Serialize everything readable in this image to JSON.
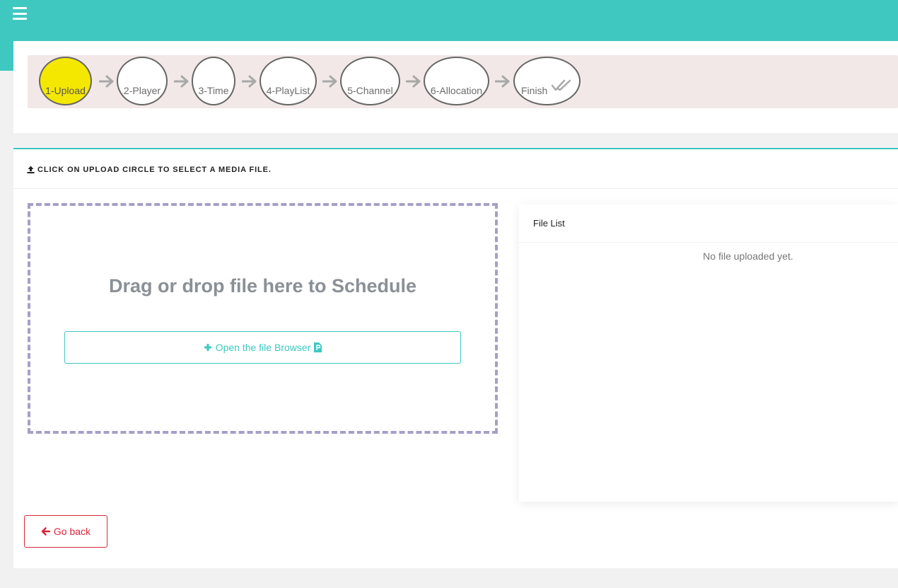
{
  "header": {
    "menu_icon": "hamburger-icon",
    "color": "#3ec8c0"
  },
  "wizard": {
    "steps": [
      {
        "label": "1-Upload",
        "active": true
      },
      {
        "label": "2-Player",
        "active": false
      },
      {
        "label": "3-Time",
        "active": false
      },
      {
        "label": "4-PlayList",
        "active": false
      },
      {
        "label": "5-Channel",
        "active": false
      },
      {
        "label": "6-Allocation",
        "active": false
      },
      {
        "label": "Finish",
        "active": false,
        "icon": "double-check-icon"
      }
    ],
    "active_color": "#f5e800"
  },
  "upload": {
    "heading": "CLICK ON UPLOAD CIRCLE TO SELECT A MEDIA FILE.",
    "heading_icon": "upload-icon",
    "drop_text": "Drag or drop file here to Schedule",
    "browse_label": "Open the file Browser",
    "browse_icons": [
      "plus-icon",
      "file-icon"
    ]
  },
  "file_list": {
    "title": "File List",
    "empty_text": "No file uploaded yet."
  },
  "actions": {
    "back_label": "Go back",
    "back_icon": "arrow-left-icon",
    "back_color": "#d9283c"
  }
}
